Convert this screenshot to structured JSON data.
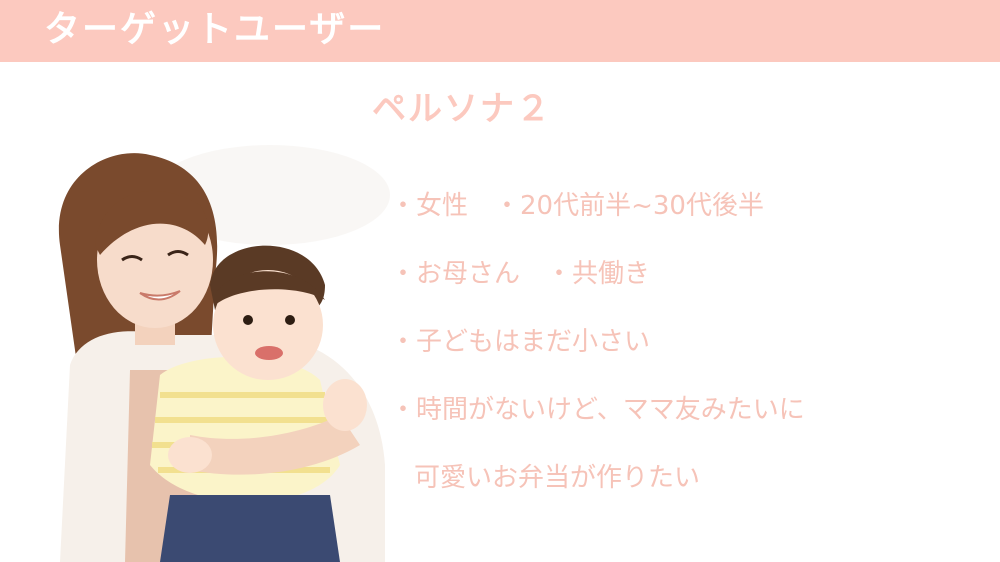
{
  "header": {
    "title": "ターゲットユーザー",
    "color": "#fcc9bf"
  },
  "persona": {
    "title": "ペルソナ２",
    "accent_color": "#fcc9bf",
    "bullets": [
      "・女性　・20代前半~30代後半",
      "・お母さん　・共働き",
      "・子どもはまだ小さい",
      "・時間がないけど、ママ友みたいに",
      "可愛いお弁当が作りたい"
    ]
  },
  "photo": {
    "subject": "mother-holding-baby-photo"
  }
}
